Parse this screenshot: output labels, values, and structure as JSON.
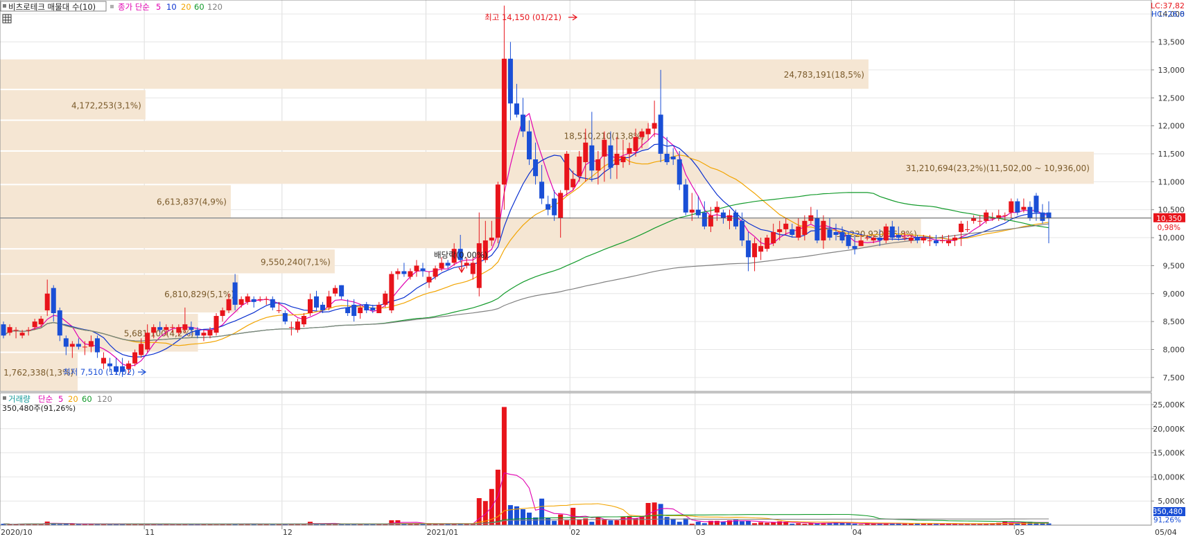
{
  "legend_top": {
    "indicator": "비츠로테크 매물대 수(10)",
    "price_label": "종가 단순",
    "periods": [
      "5",
      "10",
      "20",
      "60",
      "120"
    ],
    "period_colors": [
      "#e000b0",
      "#0a30d0",
      "#f2a400",
      "#129a2a",
      "#808080"
    ]
  },
  "legend_bottom": {
    "indicator": "거래량",
    "ma_label": "단순",
    "periods": [
      "5",
      "20",
      "60",
      "120"
    ],
    "period_colors": [
      "#e000b0",
      "#f2a400",
      "#129a2a",
      "#808080"
    ],
    "last_volume": "350,480주(91,26%)"
  },
  "corner": {
    "lc": "LC:37,82",
    "hc": "HC:-26,8"
  },
  "annotations": {
    "high": "최고 14,150 (01/21)",
    "low": "최저 7,510 (11/02)",
    "dividend": "배당락(0,00%)"
  },
  "current": {
    "price_tag": "10,350",
    "change_tag": "0,98%",
    "volume_tag": "350,480",
    "volume_pct_tag": "91,26%",
    "price": 10350
  },
  "colors": {
    "up": "#e8141b",
    "down": "#1a4fd6",
    "profile": "#f5e6d3",
    "profile_text": "#7a5a2a"
  },
  "chart_data": [
    {
      "type": "candlestick",
      "title": "비츠로테크 매물대 수(10)",
      "x_ticks": [
        "2020/10",
        "11",
        "12",
        "2021/01",
        "02",
        "03",
        "04",
        "05",
        "05/04"
      ],
      "y_ticks": [
        "7,500",
        "8,000",
        "8,500",
        "9,000",
        "9,500",
        "10,000",
        "10,500",
        "11,000",
        "11,500",
        "12,000",
        "12,500",
        "13,000",
        "13,500",
        "14,000"
      ],
      "ylim": [
        7250,
        14250
      ],
      "grid": true,
      "volume_profile": [
        {
          "lo": 7250,
          "hi": 7950,
          "label": "1,762,338(1,3%)",
          "frac": 0.071
        },
        {
          "lo": 7950,
          "hi": 8650,
          "label": "5,681,100(4,2%)",
          "frac": 0.181
        },
        {
          "lo": 8650,
          "hi": 9350,
          "label": "6,810,829(5,1%)",
          "frac": 0.218
        },
        {
          "lo": 9350,
          "hi": 9800,
          "label": "9,550,240(7,1%)",
          "frac": 0.306
        },
        {
          "lo": 9800,
          "hi": 10350,
          "label": "35,220,920(16,8%)",
          "frac": 0.842
        },
        {
          "lo": 10350,
          "hi": 10950,
          "label": "6,613,837(4,9%)",
          "frac": 0.211
        },
        {
          "lo": 10950,
          "hi": 11550,
          "label": "31,210,694(23,2%)(11,502,00 ~ 10,936,00)",
          "frac": 1.0
        },
        {
          "lo": 11550,
          "hi": 12100,
          "label": "18,510,210(13,8%)",
          "frac": 0.593
        },
        {
          "lo": 12100,
          "hi": 12650,
          "label": "4,172,253(3,1%)",
          "frac": 0.133
        },
        {
          "lo": 12650,
          "hi": 13200,
          "label": "24,783,191(18,5%)",
          "frac": 0.794
        }
      ],
      "candles_ohlc": [
        [
          8450,
          8500,
          8200,
          8250
        ],
        [
          8300,
          8450,
          8250,
          8400
        ],
        [
          8350,
          8400,
          8200,
          8350
        ],
        [
          8250,
          8350,
          8200,
          8300
        ],
        [
          8350,
          8400,
          8250,
          8350
        ],
        [
          8400,
          8550,
          8350,
          8500
        ],
        [
          8450,
          8600,
          8400,
          8550
        ],
        [
          8700,
          9250,
          8600,
          9000
        ],
        [
          9100,
          9150,
          8500,
          8650
        ],
        [
          8700,
          8750,
          8150,
          8250
        ],
        [
          8200,
          8250,
          7900,
          8050
        ],
        [
          8050,
          8150,
          7850,
          8100
        ],
        [
          8100,
          8200,
          8000,
          8050
        ],
        [
          8050,
          8150,
          7900,
          8050
        ],
        [
          8050,
          8250,
          7950,
          8150
        ],
        [
          8200,
          8250,
          7850,
          7950
        ],
        [
          7750,
          7950,
          7650,
          7850
        ],
        [
          7750,
          7850,
          7600,
          7700
        ],
        [
          7700,
          7850,
          7550,
          7600
        ],
        [
          7700,
          7850,
          7510,
          7600
        ],
        [
          7650,
          7800,
          7550,
          7750
        ],
        [
          7750,
          8000,
          7700,
          7950
        ],
        [
          7900,
          8200,
          7850,
          8100
        ],
        [
          8000,
          8450,
          7950,
          8300
        ],
        [
          8300,
          8450,
          8200,
          8400
        ],
        [
          8400,
          8500,
          8300,
          8350
        ],
        [
          8350,
          8450,
          8250,
          8400
        ],
        [
          8400,
          8450,
          8300,
          8400
        ],
        [
          8300,
          8450,
          8250,
          8400
        ],
        [
          8350,
          8750,
          8300,
          8450
        ],
        [
          8400,
          8500,
          8250,
          8350
        ],
        [
          8350,
          8400,
          8200,
          8250
        ],
        [
          8250,
          8350,
          8150,
          8300
        ],
        [
          8250,
          8400,
          8200,
          8350
        ],
        [
          8300,
          8650,
          8250,
          8600
        ],
        [
          8600,
          8750,
          8500,
          8700
        ],
        [
          8700,
          9000,
          8650,
          8900
        ],
        [
          9200,
          9350,
          8700,
          8800
        ],
        [
          8800,
          8950,
          8750,
          8900
        ],
        [
          8850,
          9000,
          8800,
          8950
        ],
        [
          8900,
          8950,
          8750,
          8850
        ],
        [
          8900,
          8950,
          8850,
          8900
        ],
        [
          8900,
          8950,
          8800,
          8900
        ],
        [
          8900,
          8950,
          8700,
          8750
        ],
        [
          8700,
          8850,
          8650,
          8700
        ],
        [
          8650,
          8700,
          8450,
          8500
        ],
        [
          8400,
          8500,
          8250,
          8400
        ],
        [
          8350,
          8550,
          8300,
          8500
        ],
        [
          8450,
          8650,
          8400,
          8600
        ],
        [
          8650,
          9000,
          8600,
          8900
        ],
        [
          8950,
          9050,
          8700,
          8750
        ],
        [
          8800,
          8850,
          8650,
          8700
        ],
        [
          8750,
          9050,
          8700,
          8950
        ],
        [
          9000,
          9150,
          8950,
          9100
        ],
        [
          9150,
          9150,
          8900,
          8950
        ],
        [
          8750,
          8900,
          8600,
          8650
        ],
        [
          8800,
          8900,
          8500,
          8600
        ],
        [
          8650,
          8800,
          8550,
          8750
        ],
        [
          8800,
          8850,
          8650,
          8700
        ],
        [
          8750,
          8800,
          8650,
          8700
        ],
        [
          8650,
          8850,
          8650,
          8800
        ],
        [
          8800,
          9050,
          8750,
          9000
        ],
        [
          8700,
          9400,
          8650,
          9350
        ],
        [
          9350,
          9450,
          9250,
          9400
        ],
        [
          9400,
          9550,
          9300,
          9350
        ],
        [
          9300,
          9450,
          9250,
          9400
        ],
        [
          9400,
          9600,
          9300,
          9500
        ],
        [
          9450,
          9550,
          9300,
          9400
        ],
        [
          9200,
          9400,
          9100,
          9300
        ],
        [
          9300,
          9500,
          9250,
          9450
        ],
        [
          9450,
          9650,
          9400,
          9550
        ],
        [
          9550,
          9600,
          9450,
          9500
        ],
        [
          9550,
          9900,
          9500,
          9800
        ],
        [
          9800,
          10050,
          9550,
          9600
        ],
        [
          9500,
          9650,
          9450,
          9550
        ],
        [
          9350,
          9650,
          9250,
          9550
        ],
        [
          9100,
          10450,
          8950,
          9900
        ],
        [
          9600,
          10300,
          9550,
          9950
        ],
        [
          9950,
          10300,
          9850,
          10000
        ],
        [
          10000,
          11000,
          9900,
          10950
        ],
        [
          10950,
          14150,
          10500,
          13200
        ],
        [
          13200,
          13500,
          12100,
          12400
        ],
        [
          12400,
          12750,
          12150,
          12200
        ],
        [
          12200,
          12500,
          11800,
          11900
        ],
        [
          11900,
          12100,
          11300,
          11400
        ],
        [
          11400,
          11700,
          10950,
          11100
        ],
        [
          11000,
          11300,
          10600,
          10700
        ],
        [
          10600,
          10750,
          10400,
          10500
        ],
        [
          10700,
          10850,
          10300,
          10400
        ],
        [
          10350,
          10850,
          10000,
          10800
        ],
        [
          10850,
          11550,
          10750,
          11500
        ],
        [
          10900,
          11200,
          10850,
          11050
        ],
        [
          11100,
          11550,
          11000,
          11450
        ],
        [
          11350,
          11950,
          11000,
          11700
        ],
        [
          11650,
          12250,
          11000,
          11200
        ],
        [
          11200,
          11550,
          10950,
          11400
        ],
        [
          11450,
          11900,
          11000,
          11750
        ],
        [
          11650,
          11900,
          11050,
          11250
        ],
        [
          11300,
          11800,
          11050,
          11500
        ],
        [
          11350,
          11750,
          11250,
          11450
        ],
        [
          11500,
          11700,
          11300,
          11600
        ],
        [
          11550,
          11950,
          11450,
          11800
        ],
        [
          11800,
          11950,
          11600,
          11900
        ],
        [
          11850,
          12050,
          11750,
          11950
        ],
        [
          11950,
          12450,
          11800,
          12050
        ],
        [
          12200,
          13000,
          11350,
          11500
        ],
        [
          11500,
          11800,
          11300,
          11350
        ],
        [
          11450,
          11600,
          11300,
          11400
        ],
        [
          11400,
          11550,
          10850,
          10950
        ],
        [
          10950,
          11050,
          10400,
          10450
        ],
        [
          10450,
          10800,
          10300,
          10500
        ],
        [
          10500,
          10750,
          10350,
          10400
        ],
        [
          10450,
          10650,
          10150,
          10200
        ],
        [
          10200,
          10550,
          10100,
          10400
        ],
        [
          10450,
          10650,
          10300,
          10550
        ],
        [
          10450,
          10500,
          10250,
          10350
        ],
        [
          10300,
          10500,
          10150,
          10400
        ],
        [
          10450,
          10500,
          10150,
          10200
        ],
        [
          10300,
          10450,
          9850,
          9950
        ],
        [
          9950,
          10100,
          9400,
          9650
        ],
        [
          9650,
          10000,
          9400,
          9900
        ],
        [
          9750,
          10000,
          9600,
          9850
        ],
        [
          9800,
          10050,
          9750,
          10000
        ],
        [
          9900,
          10250,
          9850,
          10100
        ],
        [
          10100,
          10300,
          9950,
          10150
        ],
        [
          10150,
          10350,
          10050,
          10250
        ],
        [
          10150,
          10250,
          10000,
          10050
        ],
        [
          10000,
          10350,
          9950,
          10200
        ],
        [
          10050,
          10400,
          9950,
          10300
        ],
        [
          10300,
          10550,
          10250,
          10400
        ],
        [
          10350,
          10500,
          9900,
          9950
        ],
        [
          9950,
          10400,
          9800,
          10300
        ],
        [
          10150,
          10350,
          9950,
          10000
        ],
        [
          10100,
          10250,
          9950,
          10050
        ],
        [
          10100,
          10200,
          9900,
          9950
        ],
        [
          10050,
          10100,
          9800,
          9850
        ],
        [
          9850,
          10050,
          9700,
          9800
        ],
        [
          9850,
          10050,
          9850,
          9950
        ],
        [
          10000,
          10050,
          9950,
          10000
        ],
        [
          9950,
          10050,
          9900,
          10000
        ],
        [
          10000,
          10150,
          9850,
          9950
        ],
        [
          9950,
          10250,
          9900,
          10200
        ],
        [
          10200,
          10300,
          9950,
          10000
        ],
        [
          10050,
          10200,
          9950,
          10000
        ],
        [
          10000,
          10100,
          9950,
          10000
        ],
        [
          9950,
          10050,
          9900,
          10000
        ],
        [
          10000,
          10050,
          9900,
          9950
        ],
        [
          9950,
          10050,
          9900,
          10000
        ],
        [
          9950,
          10050,
          9850,
          9950
        ],
        [
          9950,
          10050,
          9850,
          9900
        ],
        [
          9950,
          10050,
          9900,
          9950
        ],
        [
          9900,
          10050,
          9850,
          9950
        ],
        [
          9950,
          10050,
          9850,
          10000
        ],
        [
          10100,
          10300,
          9850,
          10250
        ],
        [
          10150,
          10300,
          10100,
          10150
        ],
        [
          10300,
          10400,
          10250,
          10350
        ],
        [
          10300,
          10400,
          10200,
          10300
        ],
        [
          10300,
          10500,
          10250,
          10450
        ],
        [
          10350,
          10450,
          10300,
          10350
        ],
        [
          10350,
          10500,
          10300,
          10400
        ],
        [
          10400,
          10450,
          10300,
          10400
        ],
        [
          10450,
          10700,
          10350,
          10650
        ],
        [
          10650,
          10700,
          10400,
          10450
        ],
        [
          10500,
          10700,
          10450,
          10550
        ],
        [
          10550,
          10650,
          10300,
          10350
        ],
        [
          10750,
          10800,
          10300,
          10450
        ],
        [
          10450,
          10600,
          10250,
          10300
        ],
        [
          10450,
          10650,
          9900,
          10350
        ]
      ],
      "ma_periods": [
        5,
        10,
        20,
        60,
        120
      ]
    },
    {
      "type": "bar",
      "title": "거래량",
      "y_ticks": [
        "5,000K",
        "10,000K",
        "15,000K",
        "20,000K",
        "25,000K"
      ],
      "ylim": [
        0,
        26000
      ],
      "unit": "K",
      "values_k": [
        285,
        178,
        178,
        264,
        289,
        317,
        220,
        744,
        394,
        201,
        218,
        216,
        228,
        282,
        244,
        162,
        294,
        153,
        230,
        241,
        227,
        198,
        159,
        189,
        242,
        172,
        290,
        138,
        216,
        207,
        195,
        168,
        264,
        235,
        135,
        298,
        222,
        256,
        276,
        275,
        237,
        152,
        181,
        212,
        279,
        210,
        248,
        238,
        251,
        705,
        227,
        257,
        354,
        294,
        198,
        283,
        158,
        293,
        155,
        268,
        304,
        158,
        1010,
        1020,
        345,
        300,
        283,
        255,
        249,
        248,
        299,
        245,
        278,
        275,
        323,
        319,
        5600,
        5000,
        7500,
        11500,
        24500,
        4150,
        3900,
        3300,
        2600,
        1600,
        5500,
        1500,
        900,
        2200,
        1000,
        3600,
        1100,
        1400,
        700,
        1600,
        1200,
        1000,
        1000,
        1700,
        1900,
        1400,
        1900,
        4600,
        4700,
        4400,
        1700,
        1300,
        700,
        1400,
        300,
        700,
        400,
        900,
        900,
        700,
        1000,
        1100,
        800,
        900,
        400,
        600,
        500,
        600,
        800,
        700,
        300,
        400,
        300,
        500,
        400,
        400,
        500,
        600,
        450,
        400,
        300,
        200,
        400,
        350,
        300,
        400,
        300,
        350,
        400,
        350,
        300,
        300,
        350,
        250,
        250,
        350,
        300,
        200,
        250,
        300,
        300,
        300,
        400,
        500,
        750,
        600,
        400,
        600,
        700,
        550,
        500,
        350
      ]
    }
  ]
}
